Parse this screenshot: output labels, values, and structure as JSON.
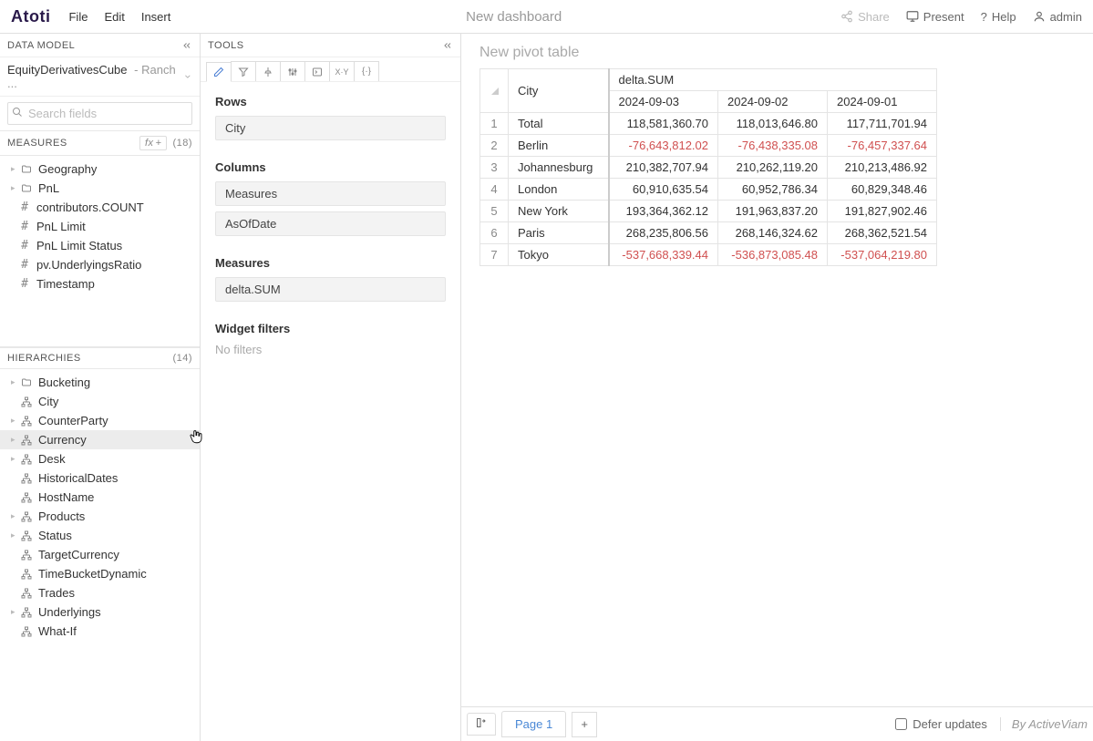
{
  "header": {
    "logo": "Atoti",
    "menu": [
      "File",
      "Edit",
      "Insert"
    ],
    "title": "New dashboard",
    "share": "Share",
    "present": "Present",
    "help": "Help",
    "user": "admin"
  },
  "dataModel": {
    "title": "DATA MODEL",
    "cubeName": "EquityDerivativesCube",
    "cubeSub": "Ranch ...",
    "searchPlaceholder": "Search fields",
    "measures": {
      "title": "MEASURES",
      "fxLabel": "fx",
      "count": "(18)",
      "folders": [
        "Geography",
        "PnL"
      ],
      "items": [
        "contributors.COUNT",
        "PnL Limit",
        "PnL Limit Status",
        "pv.UnderlyingsRatio",
        "Timestamp"
      ]
    },
    "hierarchies": {
      "title": "HIERARCHIES",
      "count": "(14)",
      "items": [
        {
          "label": "Bucketing",
          "icon": "folder",
          "expandable": true
        },
        {
          "label": "City",
          "icon": "hier",
          "expandable": false
        },
        {
          "label": "CounterParty",
          "icon": "hier",
          "expandable": true
        },
        {
          "label": "Currency",
          "icon": "hier",
          "expandable": true,
          "hovered": true
        },
        {
          "label": "Desk",
          "icon": "hier",
          "expandable": true
        },
        {
          "label": "HistoricalDates",
          "icon": "hier",
          "expandable": false
        },
        {
          "label": "HostName",
          "icon": "hier",
          "expandable": false
        },
        {
          "label": "Products",
          "icon": "hier",
          "expandable": true
        },
        {
          "label": "Status",
          "icon": "hier",
          "expandable": true
        },
        {
          "label": "TargetCurrency",
          "icon": "hier",
          "expandable": false
        },
        {
          "label": "TimeBucketDynamic",
          "icon": "hier",
          "expandable": false
        },
        {
          "label": "Trades",
          "icon": "hier",
          "expandable": false
        },
        {
          "label": "Underlyings",
          "icon": "hier",
          "expandable": true
        },
        {
          "label": "What-If",
          "icon": "hier",
          "expandable": false
        }
      ]
    }
  },
  "tools": {
    "title": "TOOLS",
    "rowsLabel": "Rows",
    "rowsChips": [
      "City"
    ],
    "columnsLabel": "Columns",
    "columnsChips": [
      "Measures",
      "AsOfDate"
    ],
    "measuresLabel": "Measures",
    "measuresChips": [
      "delta.SUM"
    ],
    "filtersLabel": "Widget filters",
    "noFilters": "No filters"
  },
  "pivot": {
    "title": "New pivot table",
    "rowHeader": "City",
    "measureHeader": "delta.SUM",
    "dates": [
      "2024-09-03",
      "2024-09-02",
      "2024-09-01"
    ],
    "rows": [
      {
        "n": "1",
        "city": "Total",
        "v": [
          "118,581,360.70",
          "118,013,646.80",
          "117,711,701.94"
        ],
        "neg": [
          false,
          false,
          false
        ]
      },
      {
        "n": "2",
        "city": "Berlin",
        "v": [
          "-76,643,812.02",
          "-76,438,335.08",
          "-76,457,337.64"
        ],
        "neg": [
          true,
          true,
          true
        ]
      },
      {
        "n": "3",
        "city": "Johannesburg",
        "v": [
          "210,382,707.94",
          "210,262,119.20",
          "210,213,486.92"
        ],
        "neg": [
          false,
          false,
          false
        ]
      },
      {
        "n": "4",
        "city": "London",
        "v": [
          "60,910,635.54",
          "60,952,786.34",
          "60,829,348.46"
        ],
        "neg": [
          false,
          false,
          false
        ]
      },
      {
        "n": "5",
        "city": "New York",
        "v": [
          "193,364,362.12",
          "191,963,837.20",
          "191,827,902.46"
        ],
        "neg": [
          false,
          false,
          false
        ]
      },
      {
        "n": "6",
        "city": "Paris",
        "v": [
          "268,235,806.56",
          "268,146,324.62",
          "268,362,521.54"
        ],
        "neg": [
          false,
          false,
          false
        ]
      },
      {
        "n": "7",
        "city": "Tokyo",
        "v": [
          "-537,668,339.44",
          "-536,873,085.48",
          "-537,064,219.80"
        ],
        "neg": [
          true,
          true,
          true
        ]
      }
    ]
  },
  "footer": {
    "page": "Page 1",
    "defer": "Defer updates",
    "by": "By ActiveViam"
  }
}
